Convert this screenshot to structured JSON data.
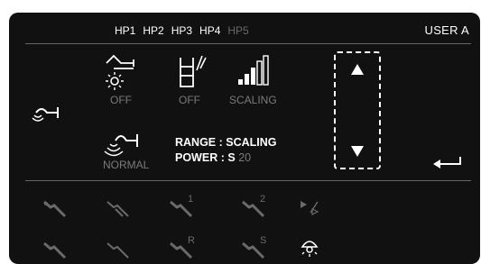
{
  "header": {
    "tabs": [
      {
        "label": "HP1",
        "active": true
      },
      {
        "label": "HP2",
        "active": true
      },
      {
        "label": "HP3",
        "active": true
      },
      {
        "label": "HP4",
        "active": true
      },
      {
        "label": "HP5",
        "active": false
      }
    ],
    "user": "USER A"
  },
  "controls": {
    "light_status": "OFF",
    "spray_status": "OFF",
    "power_mode": "SCALING",
    "irrigation_mode": "NORMAL"
  },
  "info": {
    "range_label": "RANGE",
    "range_value": "SCALING",
    "power_label": "POWER",
    "power_setting": "S",
    "power_value": "20"
  },
  "icons": {
    "left_handpiece": "handpiece-icon",
    "light": "handpiece-light-icon",
    "spray": "spray-icon",
    "power": "power-bars-icon",
    "irrigation": "irrigation-icon",
    "scroll_up": "triangle-up-icon",
    "scroll_down": "triangle-down-icon",
    "enter": "enter-icon"
  },
  "tools_row1": [
    "",
    "",
    "1",
    "2",
    ""
  ],
  "tools_row2": [
    "",
    "",
    "R",
    "S",
    ""
  ],
  "colors": {
    "background": "#111111",
    "text": "#ffffff",
    "dim": "#6a6a6a"
  }
}
